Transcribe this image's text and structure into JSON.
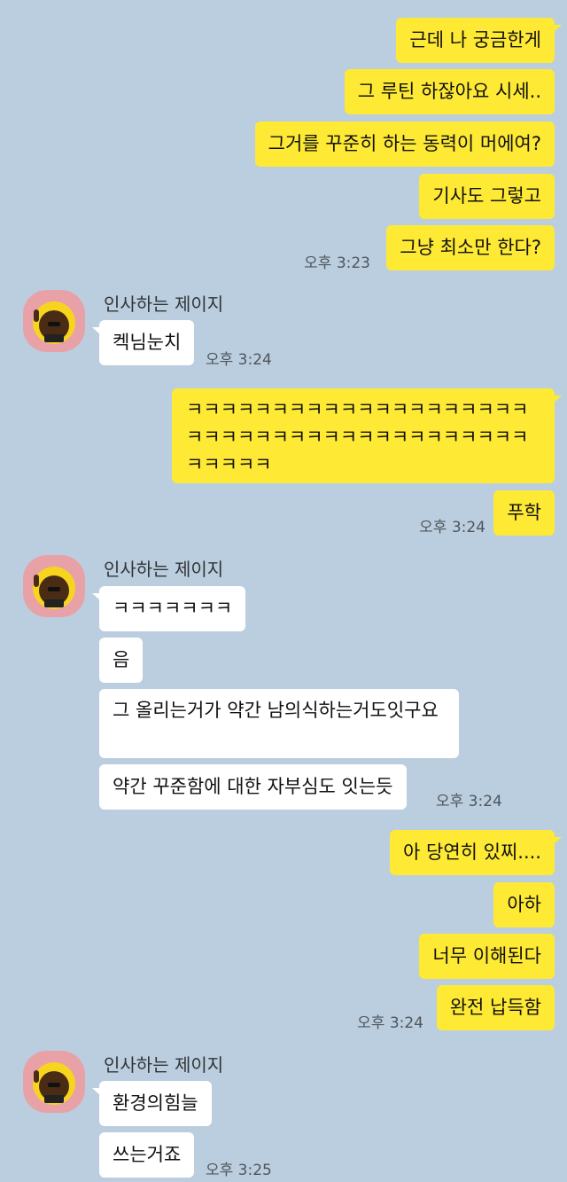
{
  "sender_name": "인사하는 제이지",
  "colors": {
    "background": "#bacee0",
    "my_bubble": "#fee934",
    "their_bubble": "#ffffff",
    "avatar_bg": "#e9a1a8"
  },
  "msgs": {
    "m1": "근데 나 궁금한게",
    "m2": "그 루틴 하잖아요 시세..",
    "m3": "그거를 꾸준히 하는 동력이 머에여?",
    "m4": "기사도 그렇고",
    "m5": "그냥 최소만 한다?",
    "t1": "오후 3:23",
    "r1": "켁님눈치",
    "t2": "오후 3:24",
    "m6": "ㅋㅋㅋㅋㅋㅋㅋㅋㅋㅋㅋㅋㅋㅋㅋㅋㅋㅋㅋㅋㅋㅋㅋㅋㅋㅋㅋㅋㅋㅋㅋㅋㅋㅋㅋㅋㅋㅋㅋㅋㅋㅋㅋㅋㅋ",
    "m7": "푸학",
    "t3": "오후 3:24",
    "r2": "ㅋㅋㅋㅋㅋㅋㅋ",
    "r3": "음",
    "r4": "그 올리는거가 약간 남의식하는거도잇구요",
    "r5": "약간 꾸준함에 대한 자부심도 잇는듯",
    "t4": "오후 3:24",
    "m8": "아 당연히 있찌....",
    "m9": "아하",
    "m10": "너무 이해된다",
    "m11": "완전 납득함",
    "t5": "오후 3:24",
    "r6": "환경의힘늘",
    "r7": "쓰는거죠",
    "t6": "오후 3:25"
  }
}
